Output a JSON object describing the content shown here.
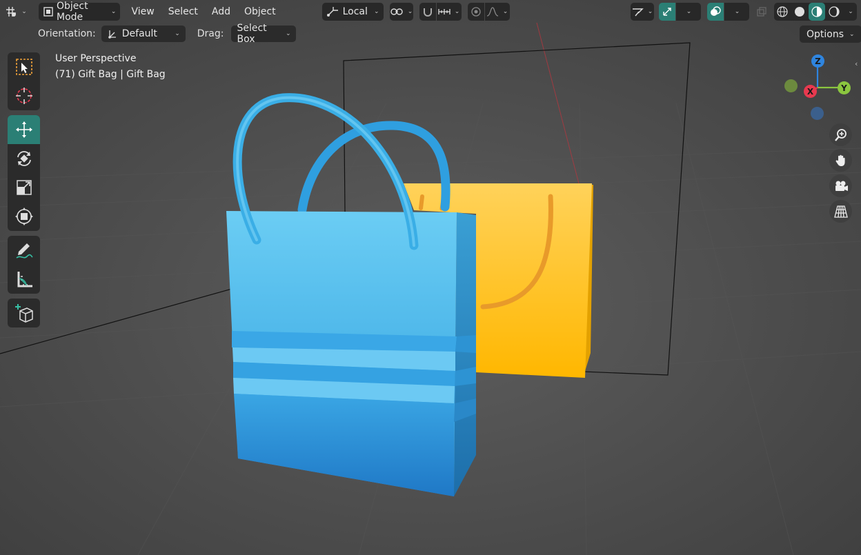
{
  "header": {
    "editor_type_icon": "3d-viewport-icon",
    "mode_label": "Object Mode",
    "menus": [
      "View",
      "Select",
      "Add",
      "Object"
    ],
    "transform_pivot_label": "Local",
    "options_label": "Options"
  },
  "tool_settings": {
    "orientation_label": "Orientation:",
    "orientation_value": "Default",
    "drag_label": "Drag:",
    "drag_value": "Select Box"
  },
  "viewport": {
    "view_name": "User Perspective",
    "object_info": "(71) Gift Bag | Gift Bag"
  },
  "toolbar": {
    "tools": [
      "select-box",
      "cursor",
      "move",
      "rotate",
      "scale",
      "transform",
      "annotate",
      "measure",
      "add-cube"
    ],
    "active_tool": "move"
  },
  "gizmo": {
    "axes": [
      "Z",
      "X",
      "Y"
    ]
  },
  "nav_buttons": [
    "zoom-icon",
    "hand-pan-icon",
    "camera-icon",
    "grid-ortho-icon"
  ],
  "colors": {
    "accent_teal": "#2b7f75",
    "axis_x": "#e8394f",
    "axis_y": "#8bc63f",
    "axis_z": "#2f85df",
    "bag_blue": "#5cc3ef",
    "bag_yellow": "#ffc21a"
  }
}
